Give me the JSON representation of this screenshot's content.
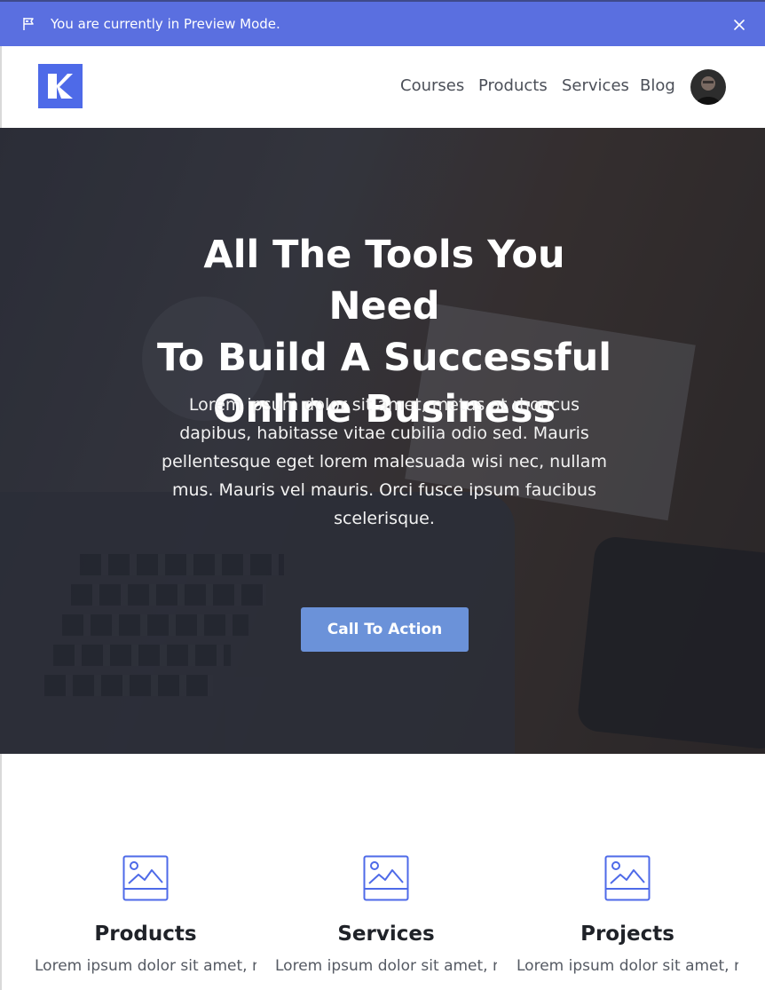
{
  "preview_bar": {
    "message": "You are currently in Preview Mode.",
    "flag_icon": "flag-icon",
    "close_icon": "close-icon",
    "color": "#5a6fe0"
  },
  "header": {
    "logo_icon": "kajabi-logo",
    "nav": [
      {
        "label": "Courses"
      },
      {
        "label": "Products"
      },
      {
        "label": "Services"
      },
      {
        "label": "Blog"
      }
    ],
    "avatar": "user-avatar"
  },
  "hero": {
    "title_lines": [
      "All The Tools You Need",
      "To Build A Successful",
      "Online Business"
    ],
    "description": "Lorem ipsum dolor sit amet, metus at rhoncus dapibus, habitasse vitae cubilia odio sed. Mauris pellentesque eget lorem malesuada wisi nec, nullam mus. Mauris vel mauris. Orci fusce ipsum faucibus scelerisque.",
    "cta_label": "Call To Action",
    "cta_color": "#6b92d9"
  },
  "features": [
    {
      "icon": "image-icon",
      "title": "Products",
      "text": "Lorem ipsum dolor sit amet, metus at rhoncus dapibus"
    },
    {
      "icon": "image-icon",
      "title": "Services",
      "text": "Lorem ipsum dolor sit amet, metus at rhoncus dapibus"
    },
    {
      "icon": "image-icon",
      "title": "Projects",
      "text": "Lorem ipsum dolor sit amet, metus at rhoncus dapibus"
    }
  ]
}
